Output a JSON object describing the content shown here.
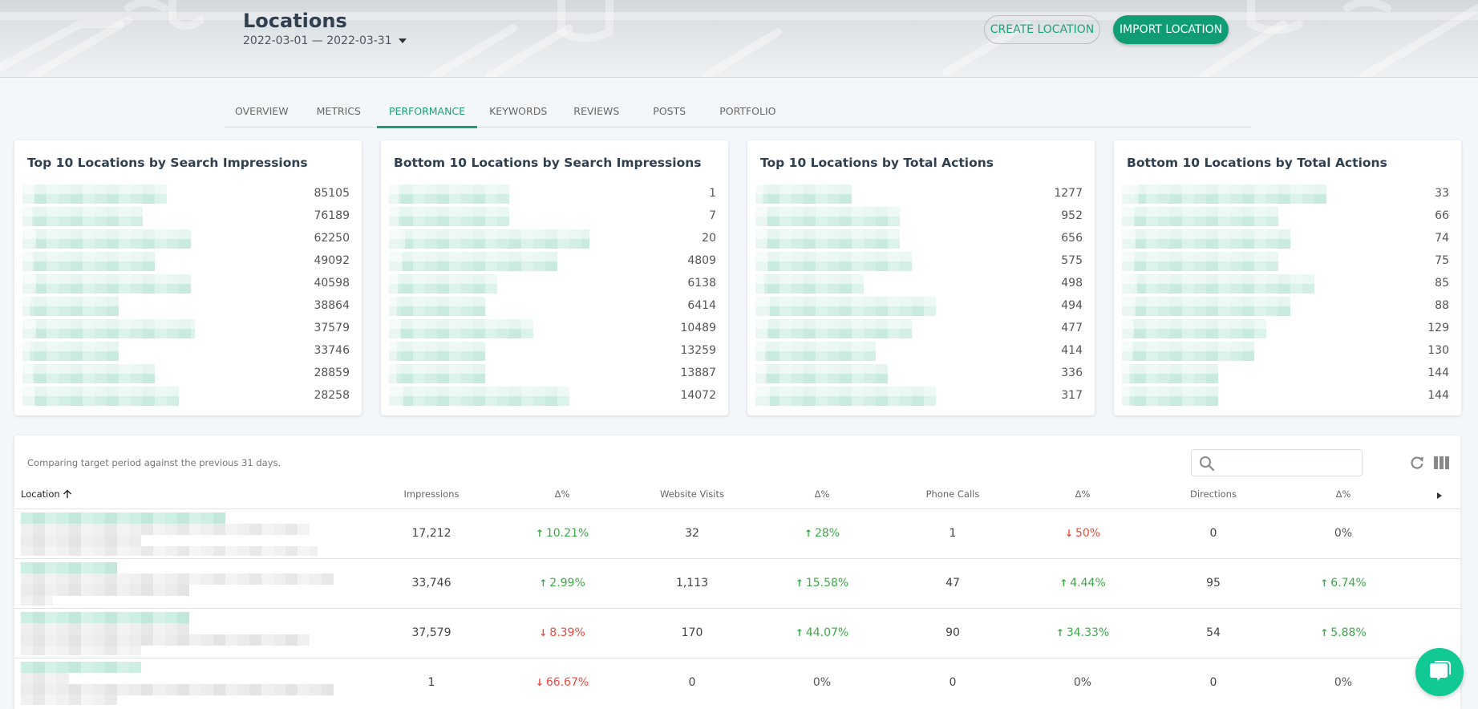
{
  "header": {
    "title": "Locations",
    "date_range": "2022-03-01 — 2022-03-31",
    "create_button": "CREATE LOCATION",
    "import_button": "IMPORT LOCATION"
  },
  "tabs": [
    {
      "label": "OVERVIEW",
      "active": false
    },
    {
      "label": "METRICS",
      "active": false
    },
    {
      "label": "PERFORMANCE",
      "active": true
    },
    {
      "label": "KEYWORDS",
      "active": false
    },
    {
      "label": "REVIEWS",
      "active": false
    },
    {
      "label": "POSTS",
      "active": false
    },
    {
      "label": "PORTFOLIO",
      "active": false
    }
  ],
  "cards": [
    {
      "title": "Top 10 Locations by Search Impressions",
      "values": [
        "85105",
        "76189",
        "62250",
        "49092",
        "40598",
        "38864",
        "37579",
        "33746",
        "28859",
        "28258"
      ]
    },
    {
      "title": "Bottom 10 Locations by Search Impressions",
      "values": [
        "1",
        "7",
        "20",
        "4809",
        "6138",
        "6414",
        "10489",
        "13259",
        "13887",
        "14072"
      ]
    },
    {
      "title": "Top 10 Locations by Total Actions",
      "values": [
        "1277",
        "952",
        "656",
        "575",
        "498",
        "494",
        "477",
        "414",
        "336",
        "317"
      ]
    },
    {
      "title": "Bottom 10 Locations by Total Actions",
      "values": [
        "33",
        "66",
        "74",
        "75",
        "85",
        "88",
        "129",
        "130",
        "144",
        "144"
      ]
    }
  ],
  "table": {
    "note": "Comparing target period against the previous 31 days.",
    "search_placeholder": "",
    "columns": [
      "Location",
      "Impressions",
      "Δ%",
      "Website Visits",
      "Δ%",
      "Phone Calls",
      "Δ%",
      "Directions",
      "Δ%"
    ],
    "rows": [
      {
        "impressions": "17,212",
        "impressions_delta": {
          "text": "10.21%",
          "dir": "up"
        },
        "website_visits": "32",
        "website_delta": {
          "text": "28%",
          "dir": "up"
        },
        "phone_calls": "1",
        "phone_delta": {
          "text": "50%",
          "dir": "down"
        },
        "directions": "0",
        "directions_delta": {
          "text": "0%",
          "dir": "neutral"
        }
      },
      {
        "impressions": "33,746",
        "impressions_delta": {
          "text": "2.99%",
          "dir": "up"
        },
        "website_visits": "1,113",
        "website_delta": {
          "text": "15.58%",
          "dir": "up"
        },
        "phone_calls": "47",
        "phone_delta": {
          "text": "4.44%",
          "dir": "up"
        },
        "directions": "95",
        "directions_delta": {
          "text": "6.74%",
          "dir": "up"
        }
      },
      {
        "impressions": "37,579",
        "impressions_delta": {
          "text": "8.39%",
          "dir": "down"
        },
        "website_visits": "170",
        "website_delta": {
          "text": "44.07%",
          "dir": "up"
        },
        "phone_calls": "90",
        "phone_delta": {
          "text": "34.33%",
          "dir": "up"
        },
        "directions": "54",
        "directions_delta": {
          "text": "5.88%",
          "dir": "up"
        }
      },
      {
        "impressions": "1",
        "impressions_delta": {
          "text": "66.67%",
          "dir": "down"
        },
        "website_visits": "0",
        "website_delta": {
          "text": "0%",
          "dir": "neutral"
        },
        "phone_calls": "0",
        "phone_delta": {
          "text": "0%",
          "dir": "neutral"
        },
        "directions": "0",
        "directions_delta": {
          "text": "0%",
          "dir": "neutral"
        }
      }
    ]
  },
  "colors": {
    "accent": "#1e9e74",
    "import_button": "#0f9d75",
    "positive": "#3fa84a",
    "negative": "#ea4b3e",
    "chat": "#10c995"
  },
  "icons": {
    "date_caret": "caret-down-icon",
    "sort": "arrow-up-icon",
    "search": "search-icon",
    "refresh": "refresh-icon",
    "columns": "columns-icon",
    "expand": "caret-right-icon",
    "chat": "chat-icon"
  }
}
